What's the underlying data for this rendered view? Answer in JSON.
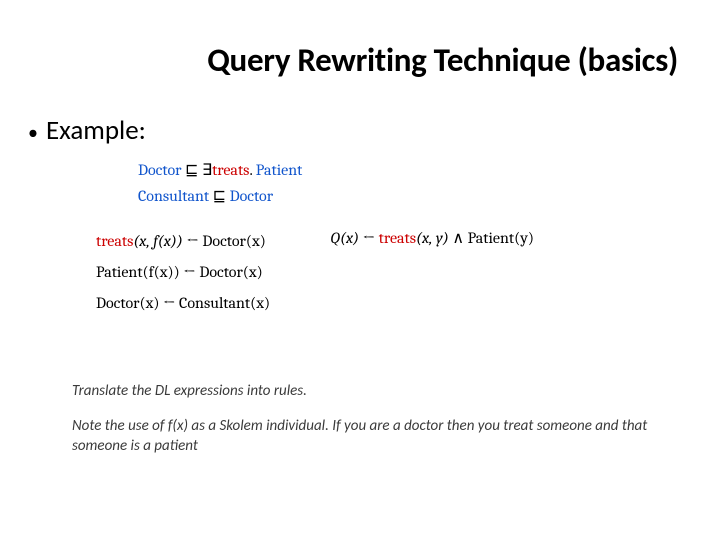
{
  "title": "Query Rewriting Technique (basics)",
  "bullet": "Example:",
  "axioms": {
    "a1": {
      "lhs": "Doctor",
      "rel": "⊑",
      "exists": "∃",
      "pred": "treats",
      "dot": ".",
      "rhs": "Patient"
    },
    "a2": {
      "lhs": "Consultant",
      "rel": "⊑",
      "rhs": "Doctor"
    }
  },
  "rules": {
    "r1": {
      "head_pred": "treats",
      "head_args": "(x, f(x))",
      "arrow": " ← ",
      "body": "Doctor(x)"
    },
    "r2": {
      "head": "Patient(f(x))",
      "arrow": " ← ",
      "body": "Doctor(x)"
    },
    "r3": {
      "head": "Doctor(x)",
      "arrow": " ← ",
      "body": "Consultant(x)"
    }
  },
  "query": {
    "head": "Q(x)",
    "arrow": " ← ",
    "b1_pred": "treats",
    "b1_args": "(x, y)",
    "conj": " ∧ ",
    "b2": "Patient(y)"
  },
  "notes": {
    "n1": "Translate the DL expressions into rules.",
    "n2": "Note the use of f(x) as a Skolem individual.  If you are a doctor then you treat someone and that someone is a patient"
  }
}
